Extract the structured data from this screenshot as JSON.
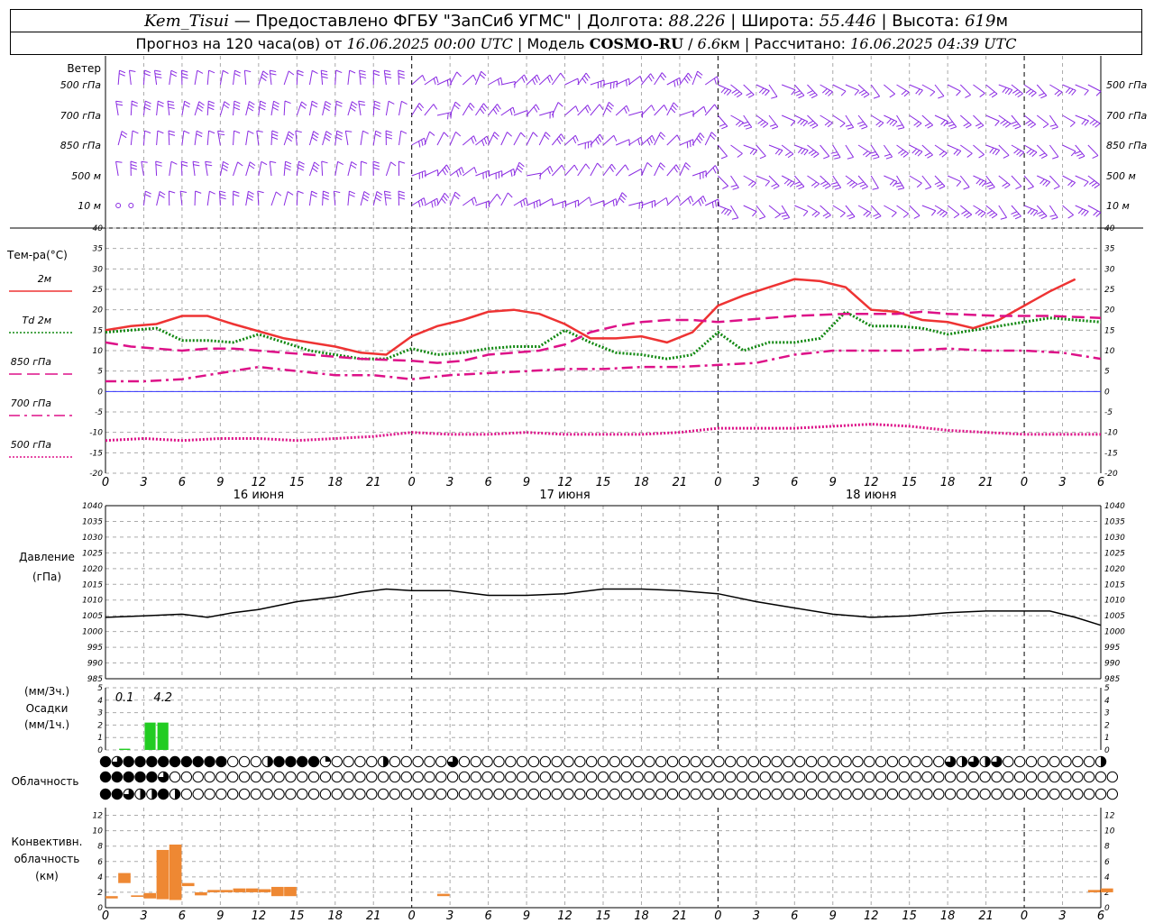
{
  "header": {
    "station": "Kem_Tisui",
    "dash": "—",
    "provided": "Предоставлено ФГБУ \"ЗапСиб УГМС\"",
    "sep": "|",
    "lon_label": "Долгота:",
    "lon": "88.226",
    "lat_label": "Широта:",
    "lat": "55.446",
    "alt_label": "Высота:",
    "alt": "619",
    "alt_unit": "м",
    "forecast_label": "Прогноз на 120 часа(ов)",
    "from_label": "от",
    "issue_time": "16.06.2025 00:00 UTC",
    "model_label": "Модель",
    "model": "COSMO-RU",
    "slash": "/",
    "res": "6.6",
    "res_unit": "км",
    "calc_label": "Рассчитано:",
    "calc_time": "16.06.2025 04:39 UTC"
  },
  "chart_data": [
    {
      "type": "wind-barbs",
      "title": "Ветер",
      "levels": [
        "500 гПа",
        "700 гПа",
        "850 гПа",
        "500 м",
        "10 м"
      ],
      "colors": {
        "barb": "#8a2be2"
      }
    },
    {
      "type": "line",
      "ylabel": "Тем-ра(°C)",
      "ylim": [
        -20,
        40
      ],
      "yticks": [
        40,
        35,
        30,
        25,
        20,
        15,
        10,
        5,
        0,
        -5,
        -10,
        -15,
        -20
      ],
      "x_hours": [
        0,
        3,
        6,
        9,
        12,
        15,
        18,
        21,
        24,
        27,
        30,
        33,
        36,
        39,
        42,
        45,
        48,
        51,
        54,
        57,
        60,
        63,
        66,
        69,
        72,
        75,
        78
      ],
      "x_tick_labels": [
        "0",
        "3",
        "6",
        "9",
        "12",
        "15",
        "18",
        "21",
        "0",
        "3",
        "6",
        "9",
        "12",
        "15",
        "18",
        "21",
        "0",
        "3",
        "6",
        "9",
        "12",
        "15",
        "18",
        "21",
        "0",
        "3",
        "6"
      ],
      "day_labels": [
        "16 июня",
        "17 июня",
        "18 июня"
      ],
      "series": [
        {
          "name": "2м",
          "color": "#ee3333",
          "style": "solid",
          "values": [
            15,
            16,
            16.5,
            18.5,
            18.5,
            16.5,
            13,
            11,
            9.5,
            9,
            13.5,
            16,
            17.5,
            19.5,
            20,
            19,
            16.5,
            13,
            13,
            13.5,
            12,
            14.5,
            21,
            23.5,
            25.5,
            27.5,
            27,
            25.5,
            20,
            19.5,
            17.5,
            17,
            15.5,
            17.5,
            21,
            24.5,
            27.5
          ],
          "xs": [
            0,
            2,
            4,
            6,
            8,
            10,
            14,
            18,
            20,
            22,
            24,
            26,
            28,
            30,
            32,
            34,
            36,
            38,
            40,
            42,
            44,
            46,
            48,
            50,
            52,
            54,
            56,
            58,
            60,
            62,
            64,
            66,
            68,
            70,
            72,
            74,
            76
          ]
        },
        {
          "name": "Td 2м",
          "color": "#118811",
          "style": "dotted",
          "values": [
            14.5,
            15,
            15.5,
            12.5,
            12.5,
            12,
            14,
            12,
            10,
            9,
            8,
            8,
            10.5,
            9,
            9.5,
            10.5,
            11,
            11,
            15,
            12,
            9.5,
            9,
            8,
            9,
            14.5,
            10,
            12,
            12,
            13,
            19.5,
            16,
            16,
            15.5,
            14,
            16,
            18,
            17
          ],
          "xs": [
            0,
            2,
            4,
            6,
            8,
            10,
            12,
            14,
            16,
            18,
            20,
            22,
            24,
            26,
            28,
            30,
            32,
            34,
            36,
            38,
            40,
            42,
            44,
            46,
            48,
            50,
            52,
            54,
            56,
            58,
            60,
            62,
            64,
            66,
            70,
            74,
            78
          ]
        },
        {
          "name": "850 гПа",
          "color": "#dd1188",
          "style": "dashed",
          "values": [
            12,
            11,
            10.5,
            10,
            10.5,
            10.5,
            10,
            9,
            8,
            7.5,
            7,
            7.5,
            9,
            10,
            11.5,
            14.5,
            16,
            17,
            17.5,
            17.5,
            17,
            17.5,
            18.5,
            19,
            19,
            19,
            19.5,
            19,
            18.5,
            18.5,
            18
          ],
          "xs": [
            0,
            2,
            4,
            6,
            8,
            10,
            12,
            16,
            20,
            24,
            26,
            28,
            30,
            34,
            36,
            38,
            40,
            42,
            44,
            46,
            48,
            50,
            54,
            58,
            60,
            62,
            64,
            66,
            70,
            74,
            78
          ]
        },
        {
          "name": "700 гПа",
          "color": "#dd1188",
          "style": "dashdot",
          "values": [
            2.5,
            2.5,
            3,
            4.5,
            6,
            5,
            4,
            4,
            3,
            4,
            4.5,
            5,
            5.5,
            5.5,
            6,
            6,
            6.5,
            7,
            9,
            10,
            10,
            10,
            10.5,
            10,
            10,
            9.5,
            8
          ],
          "xs": [
            0,
            3,
            6,
            9,
            12,
            15,
            18,
            21,
            24,
            27,
            30,
            33,
            36,
            39,
            42,
            45,
            48,
            51,
            54,
            57,
            60,
            63,
            66,
            69,
            72,
            75,
            78
          ]
        },
        {
          "name": "500 гПа",
          "color": "#dd1188",
          "style": "dotted",
          "values": [
            -12,
            -11.5,
            -12,
            -11.5,
            -11.5,
            -12,
            -11.5,
            -11,
            -10,
            -10.5,
            -10.5,
            -10,
            -10.5,
            -10.5,
            -10.5,
            -10,
            -9,
            -9,
            -9,
            -8.5,
            -8,
            -8.5,
            -9.5,
            -10,
            -10.5,
            -10.5,
            -10.5
          ],
          "xs": [
            0,
            3,
            6,
            9,
            12,
            15,
            18,
            21,
            24,
            27,
            30,
            33,
            36,
            39,
            42,
            45,
            48,
            51,
            54,
            57,
            60,
            63,
            66,
            69,
            72,
            75,
            78
          ]
        }
      ],
      "zero_line_color": "#3333ff"
    },
    {
      "type": "line",
      "ylabel": "Давление",
      "yunit": "(гПа)",
      "ylim": [
        985,
        1040
      ],
      "yticks": [
        1040,
        1035,
        1030,
        1025,
        1020,
        1015,
        1010,
        1005,
        1000,
        995,
        990,
        985
      ],
      "series": [
        {
          "name": "Давление",
          "color": "#000000",
          "values": [
            1004.5,
            1005,
            1005.5,
            1004.5,
            1006,
            1007,
            1009.5,
            1011,
            1012.5,
            1013.5,
            1013,
            1013,
            1011.5,
            1011.5,
            1012,
            1013.5,
            1013.5,
            1013,
            1012,
            1009.5,
            1007.5,
            1005.5,
            1004.5,
            1005,
            1006,
            1006.5,
            1006.5,
            1006.5,
            1004.5,
            1002
          ],
          "xs": [
            0,
            3,
            6,
            8,
            10,
            12,
            15,
            18,
            20,
            22,
            24,
            27,
            30,
            33,
            36,
            39,
            42,
            45,
            48,
            51,
            54,
            57,
            60,
            63,
            66,
            69,
            72,
            74,
            76,
            78
          ]
        }
      ]
    },
    {
      "type": "bar",
      "ylabel": "Осадки",
      "unit_top": "(мм/3ч.)",
      "unit_bottom": "(мм/1ч.)",
      "ylim": [
        0,
        5
      ],
      "yticks": [
        5,
        4,
        3,
        2,
        1,
        0
      ],
      "annotations": [
        {
          "hour": 1.5,
          "text": "0.1"
        },
        {
          "hour": 4.5,
          "text": "4.2"
        }
      ],
      "bars": [
        {
          "hour": 1,
          "width": 1,
          "value": 0.1
        },
        {
          "hour": 3,
          "width": 1,
          "value": 2.2
        },
        {
          "hour": 4,
          "width": 1,
          "value": 2.2
        }
      ],
      "color": "#22cc22"
    },
    {
      "type": "table",
      "title": "Облачность",
      "rows": [
        [
          1,
          0.75,
          1,
          1,
          1,
          1,
          1,
          1,
          1,
          1,
          1,
          0,
          0,
          0,
          0.5,
          1,
          1,
          1,
          1,
          0.25,
          0,
          0,
          0,
          0,
          0.5,
          0,
          0,
          0,
          0,
          0,
          0.75,
          0,
          0,
          0,
          0,
          0,
          0,
          0,
          0,
          0,
          0,
          0,
          0,
          0,
          0,
          0,
          0,
          0,
          0,
          0,
          0,
          0,
          0,
          0,
          0,
          0,
          0,
          0,
          0,
          0,
          0,
          0,
          0,
          0,
          0,
          0,
          0,
          0,
          0,
          0,
          0,
          0,
          0,
          0.75,
          0.5,
          0.75,
          0.5,
          0.75,
          0,
          0,
          0,
          0,
          0,
          0,
          0,
          0,
          0.5
        ],
        [
          1,
          1,
          1,
          1,
          1,
          0.75,
          0,
          0,
          0,
          0,
          0,
          0,
          0,
          0,
          0,
          0,
          0,
          0,
          0,
          0,
          0,
          0,
          0,
          0,
          0,
          0,
          0,
          0,
          0,
          0,
          0,
          0,
          0,
          0,
          0,
          0,
          0,
          0,
          0,
          0,
          0,
          0,
          0,
          0,
          0,
          0,
          0,
          0,
          0,
          0,
          0,
          0,
          0,
          0,
          0,
          0,
          0,
          0,
          0,
          0,
          0,
          0,
          0,
          0,
          0,
          0,
          0,
          0,
          0,
          0,
          0,
          0,
          0,
          0,
          0,
          0,
          0,
          0,
          0,
          0,
          0,
          0,
          0,
          0,
          0,
          0,
          0,
          0
        ],
        [
          1,
          1,
          0.75,
          0.5,
          0.5,
          1,
          0.5,
          0,
          0,
          0,
          0,
          0,
          0,
          0,
          0,
          0,
          0,
          0,
          0,
          0,
          0,
          0,
          0,
          0,
          0,
          0,
          0,
          0,
          0,
          0,
          0,
          0,
          0,
          0,
          0,
          0,
          0,
          0,
          0,
          0,
          0,
          0,
          0,
          0,
          0,
          0,
          0,
          0,
          0,
          0,
          0,
          0,
          0,
          0,
          0,
          0,
          0,
          0,
          0,
          0,
          0,
          0,
          0,
          0,
          0,
          0,
          0,
          0,
          0,
          0,
          0,
          0,
          0,
          0,
          0,
          0,
          0,
          0,
          0,
          0,
          0,
          0,
          0,
          0,
          0,
          0,
          0,
          0
        ]
      ]
    },
    {
      "type": "bar",
      "ylabel_lines": [
        "Конвективн.",
        "облачность",
        "(км)"
      ],
      "ylim": [
        0,
        13
      ],
      "yticks": [
        12,
        10,
        8,
        6,
        4,
        2,
        0
      ],
      "color": "#ee8833",
      "bars": [
        {
          "hour": 0,
          "bottom": 1.2,
          "top": 1.5
        },
        {
          "hour": 1,
          "bottom": 3.2,
          "top": 4.5
        },
        {
          "hour": 2,
          "bottom": 1.4,
          "top": 1.6
        },
        {
          "hour": 3,
          "bottom": 1.2,
          "top": 1.9
        },
        {
          "hour": 4,
          "bottom": 1.1,
          "top": 7.5
        },
        {
          "hour": 5,
          "bottom": 1.0,
          "top": 8.2
        },
        {
          "hour": 6,
          "bottom": 2.8,
          "top": 3.2
        },
        {
          "hour": 7,
          "bottom": 1.6,
          "top": 2.0
        },
        {
          "hour": 8,
          "bottom": 2.0,
          "top": 2.3
        },
        {
          "hour": 9,
          "bottom": 2.0,
          "top": 2.3
        },
        {
          "hour": 10,
          "bottom": 2.0,
          "top": 2.5
        },
        {
          "hour": 11,
          "bottom": 2.0,
          "top": 2.5
        },
        {
          "hour": 12,
          "bottom": 2.0,
          "top": 2.4
        },
        {
          "hour": 13,
          "bottom": 1.5,
          "top": 2.7
        },
        {
          "hour": 14,
          "bottom": 1.5,
          "top": 2.7
        },
        {
          "hour": 26,
          "bottom": 1.5,
          "top": 1.8
        },
        {
          "hour": 77,
          "bottom": 2.0,
          "top": 2.3
        },
        {
          "hour": 78,
          "bottom": 2.0,
          "top": 2.5
        }
      ]
    }
  ]
}
